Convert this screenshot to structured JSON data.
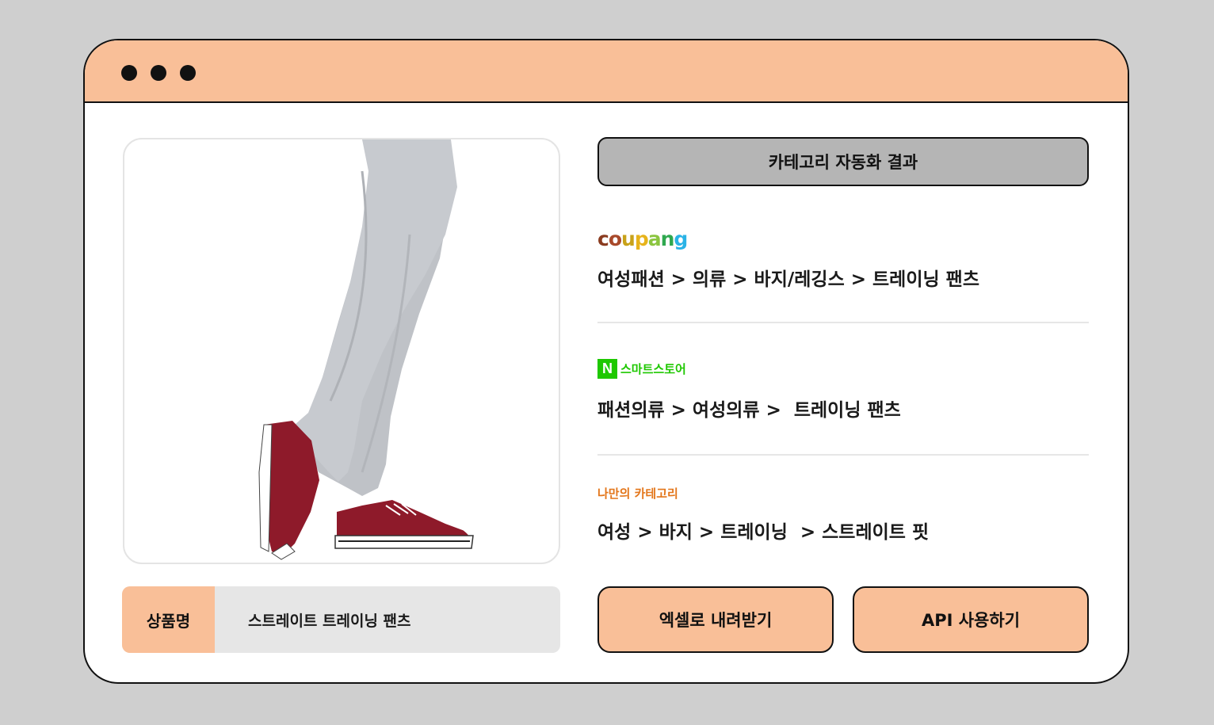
{
  "window": {
    "dots": [
      "dot",
      "dot",
      "dot"
    ]
  },
  "product": {
    "image_alt": "product-photo-gray-training-pants",
    "name_label": "상품명",
    "name_value": "스트레이트 트레이닝 팬츠"
  },
  "results": {
    "header": "카테고리 자동화 결과",
    "coupang": {
      "logo_letters": [
        "c",
        "o",
        "u",
        "p",
        "a",
        "n",
        "g"
      ],
      "logo_colors": [
        "#8a3b1f",
        "#a8492b",
        "#c8a21a",
        "#e7b31b",
        "#8bc53f",
        "#2fa84f",
        "#2ab3e6"
      ],
      "path": "여성패션 > 의류 > 바지/레깅스 > 트레이닝 팬츠"
    },
    "smartstore": {
      "badge": "N",
      "label": "스마트스토어",
      "path": "패션의류 > 여성의류 >  트레이닝 팬츠"
    },
    "custom": {
      "label": "나만의 카테고리",
      "path": "여성 > 바지 > 트레이닝  > 스트레이트 핏"
    }
  },
  "actions": {
    "excel_label": "엑셀로 내려받기",
    "api_label": "API 사용하기"
  },
  "colors": {
    "accent": "#f9bf98",
    "background": "#cfcfcf",
    "header_gray": "#b5b5b5",
    "naver_green": "#1ec800",
    "custom_orange": "#e3761b"
  }
}
